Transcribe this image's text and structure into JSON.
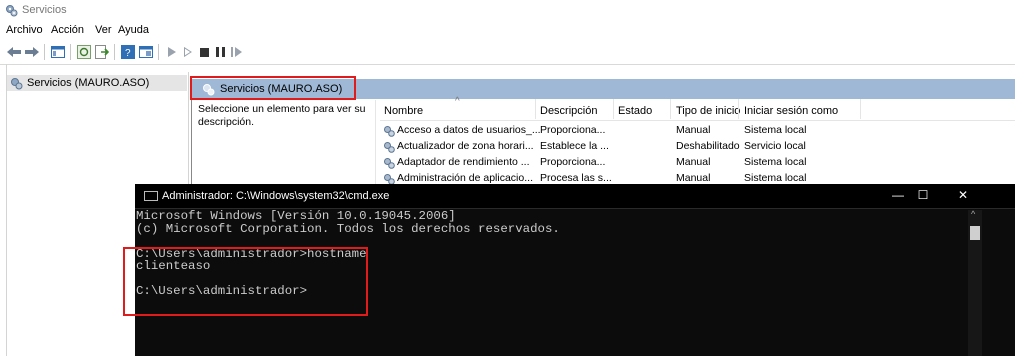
{
  "window": {
    "title": "Servicios",
    "icon": "services-gear-icon"
  },
  "menu": [
    "Archivo",
    "Acción",
    "Ver",
    "Ayuda"
  ],
  "toolbar": {
    "icons": [
      "back-arrow-icon",
      "forward-arrow-icon",
      "show-hide-tree-icon",
      "console-tree-icon",
      "refresh-icon",
      "export-list-icon",
      "help-icon",
      "properties-icon",
      "play-icon",
      "play-outline-icon",
      "stop-icon",
      "pause-icon",
      "restart-icon"
    ]
  },
  "tree": {
    "root_label": "Servicios (MAURO.ASO)"
  },
  "right_panel": {
    "tab_label": "Servicios (MAURO.ASO)",
    "description": "Seleccione un elemento para ver su descripción."
  },
  "table": {
    "columns": [
      "Nombre",
      "Descripción",
      "Estado",
      "Tipo de inicio",
      "Iniciar sesión como"
    ],
    "rows": [
      {
        "name": "Acceso a datos de usuarios_...",
        "description": "Proporciona...",
        "status": "",
        "startup": "Manual",
        "logon": "Sistema local"
      },
      {
        "name": "Actualizador de zona horari...",
        "description": "Establece la ...",
        "status": "",
        "startup": "Deshabilitado",
        "logon": "Servicio local"
      },
      {
        "name": "Adaptador de rendimiento ...",
        "description": "Proporciona...",
        "status": "",
        "startup": "Manual",
        "logon": "Sistema local"
      },
      {
        "name": "Administración de aplicacio...",
        "description": "Procesa las s...",
        "status": "",
        "startup": "Manual",
        "logon": "Sistema local"
      }
    ]
  },
  "cmd": {
    "title": "Administrador: C:\\Windows\\system32\\cmd.exe",
    "lines": [
      "Microsoft Windows [Versión 10.0.19045.2006]",
      "(c) Microsoft Corporation. Todos los derechos reservados.",
      "",
      "C:\\Users\\administrador>hostname",
      "clienteaso",
      "",
      "C:\\Users\\administrador>"
    ],
    "buttons": {
      "minimize": "—",
      "maximize": "☐",
      "close": "✕"
    }
  },
  "colors": {
    "highlight": "#e01b1b",
    "header_band": "#9eb8d6",
    "console_bg": "#0c0c0c"
  }
}
